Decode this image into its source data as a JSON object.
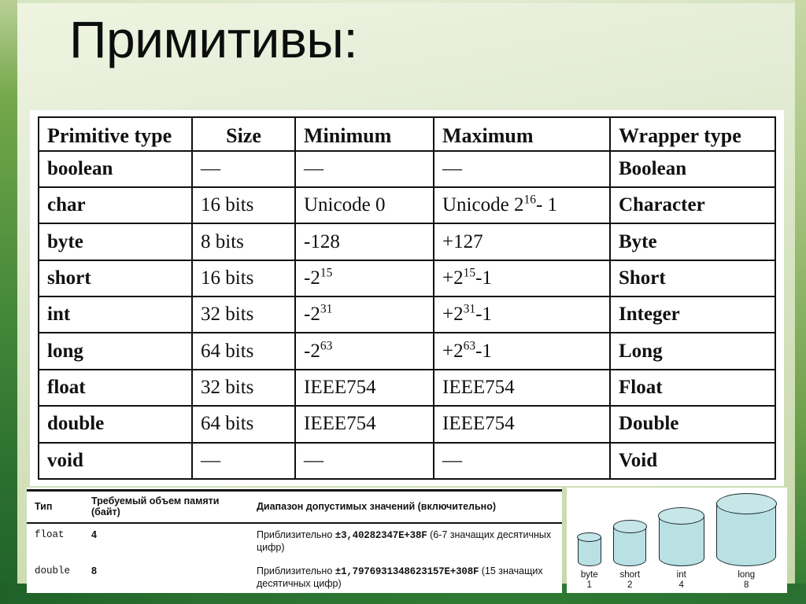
{
  "slide": {
    "title": "Примитивы:",
    "accent_green_dark": "#2a7030",
    "accent_green_light": "#cddcb2",
    "cylinder_fill": "#b9e0e2",
    "cylinder_stroke": "#1b2b33"
  },
  "primitives_table": {
    "headers": [
      "Primitive type",
      "Size",
      "Minimum",
      "Maximum",
      "Wrapper type"
    ],
    "rows": [
      {
        "type": "boolean",
        "size": "—",
        "min": "—",
        "max": "—",
        "wrapper": "Boolean",
        "max_sup": "",
        "max_tail": ""
      },
      {
        "type": "char",
        "size": "16 bits",
        "min": "Unicode 0",
        "max": "Unicode 2",
        "max_sup": "16",
        "max_tail": "- 1",
        "wrapper": "Character"
      },
      {
        "type": "byte",
        "size": "8 bits",
        "min": "-128",
        "max": "+127",
        "max_sup": "",
        "max_tail": "",
        "wrapper": "Byte"
      },
      {
        "type": "short",
        "size": "16 bits",
        "min": "-2",
        "min_sup": "15",
        "max": "+2",
        "max_sup": "15",
        "max_tail": "-1",
        "wrapper": "Short"
      },
      {
        "type": "int",
        "size": "32 bits",
        "min": "-2",
        "min_sup": "31",
        "max": "+2",
        "max_sup": "31",
        "max_tail": "-1",
        "wrapper": "Integer"
      },
      {
        "type": "long",
        "size": "64 bits",
        "min": "-2",
        "min_sup": "63",
        "max": "+2",
        "max_sup": "63",
        "max_tail": "-1",
        "wrapper": "Long"
      },
      {
        "type": "float",
        "size": "32 bits",
        "min": "IEEE754",
        "max": "IEEE754",
        "max_sup": "",
        "max_tail": "",
        "wrapper": "Float"
      },
      {
        "type": "double",
        "size": "64 bits",
        "min": "IEEE754",
        "max": "IEEE754",
        "max_sup": "",
        "max_tail": "",
        "wrapper": "Double"
      },
      {
        "type": "void",
        "size": "—",
        "min": "—",
        "max": "—",
        "max_sup": "",
        "max_tail": "",
        "wrapper": "Void"
      }
    ]
  },
  "memory_table": {
    "headers": [
      "Тип",
      "Требуемый объем памяти (байт)",
      "Диапазон допустимых значений (включительно)"
    ],
    "rows": [
      {
        "type": "float",
        "bytes": "4",
        "range_prefix": "Приблизительно ",
        "range_value": "±3,40282347E+38F",
        "range_suffix": " (6-7 значащих десятичных цифр)"
      },
      {
        "type": "double",
        "bytes": "8",
        "range_prefix": "Приблизительно ",
        "range_value": "±1,7976931348623157E+308F",
        "range_suffix": " (15 значащих десятичных цифр)"
      }
    ]
  },
  "size_diagram": {
    "items": [
      {
        "label": "byte",
        "value": "1"
      },
      {
        "label": "short",
        "value": "2"
      },
      {
        "label": "int",
        "value": "4"
      },
      {
        "label": "long",
        "value": "8"
      }
    ]
  }
}
